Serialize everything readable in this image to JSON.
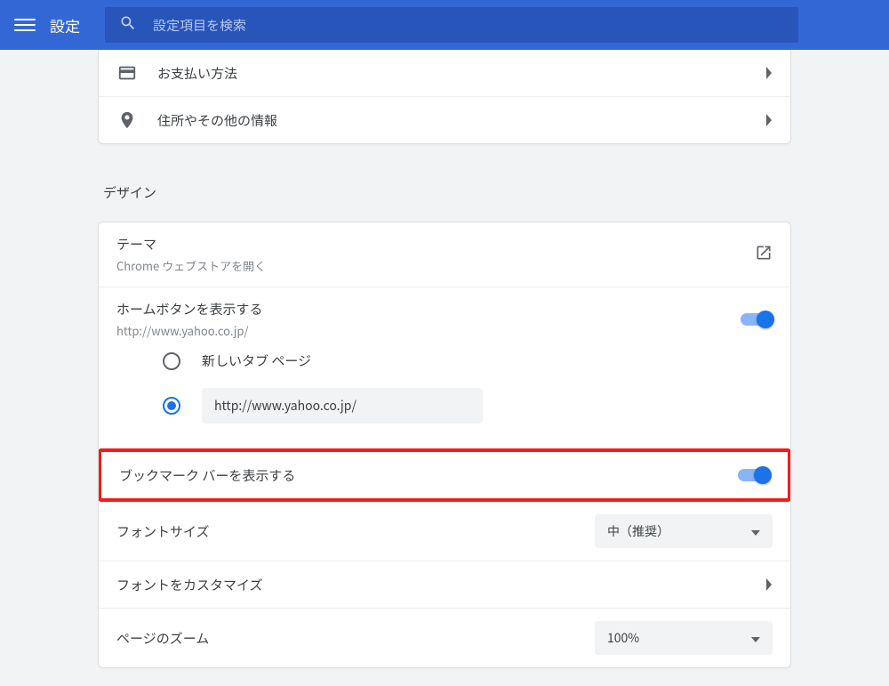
{
  "header": {
    "title": "設定",
    "search_placeholder": "設定項目を検索"
  },
  "autofill": {
    "payment_label": "お支払い方法",
    "address_label": "住所やその他の情報"
  },
  "design": {
    "section_title": "デザイン",
    "theme": {
      "title": "テーマ",
      "sub": "Chrome ウェブストアを開く"
    },
    "home_button": {
      "title": "ホームボタンを表示する",
      "sub": "http://www.yahoo.co.jp/",
      "options": {
        "new_tab": "新しいタブ ページ",
        "custom_url": "http://www.yahoo.co.jp/"
      }
    },
    "bookmark_bar": "ブックマーク バーを表示する",
    "font_size": {
      "label": "フォントサイズ",
      "value": "中（推奨）"
    },
    "font_customize": "フォントをカスタマイズ",
    "page_zoom": {
      "label": "ページのズーム",
      "value": "100%"
    }
  }
}
